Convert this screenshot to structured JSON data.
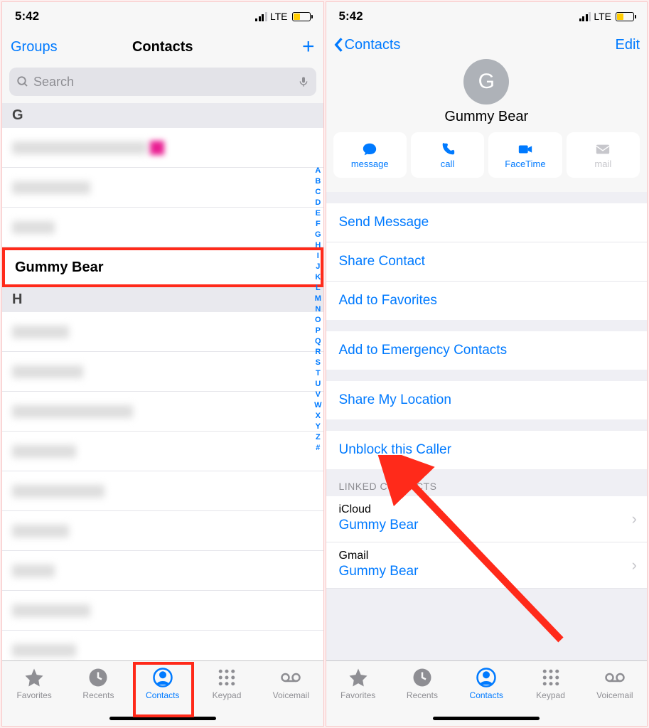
{
  "status": {
    "time": "5:42",
    "carrier": "LTE"
  },
  "left": {
    "nav": {
      "groups": "Groups",
      "title": "Contacts"
    },
    "search_placeholder": "Search",
    "sections": {
      "g_label": "G",
      "gummy": "Gummy Bear",
      "h_label": "H"
    },
    "index": [
      "A",
      "B",
      "C",
      "D",
      "E",
      "F",
      "G",
      "H",
      "I",
      "J",
      "K",
      "L",
      "M",
      "N",
      "O",
      "P",
      "Q",
      "R",
      "S",
      "T",
      "U",
      "V",
      "W",
      "X",
      "Y",
      "Z",
      "#"
    ],
    "tabs": {
      "fav": "Favorites",
      "rec": "Recents",
      "con": "Contacts",
      "key": "Keypad",
      "vm": "Voicemail"
    }
  },
  "right": {
    "nav": {
      "back": "Contacts",
      "edit": "Edit"
    },
    "avatar_letter": "G",
    "contact_name": "Gummy Bear",
    "actions": {
      "message": "message",
      "call": "call",
      "facetime": "FaceTime",
      "mail": "mail"
    },
    "options": {
      "send": "Send Message",
      "share": "Share Contact",
      "fav": "Add to Favorites",
      "emergency": "Add to Emergency Contacts",
      "location": "Share My Location",
      "unblock": "Unblock this Caller"
    },
    "linked_label": "LINKED CONTACTS",
    "linked": [
      {
        "source": "iCloud",
        "name": "Gummy Bear"
      },
      {
        "source": "Gmail",
        "name": "Gummy Bear"
      }
    ],
    "tabs": {
      "fav": "Favorites",
      "rec": "Recents",
      "con": "Contacts",
      "key": "Keypad",
      "vm": "Voicemail"
    }
  }
}
